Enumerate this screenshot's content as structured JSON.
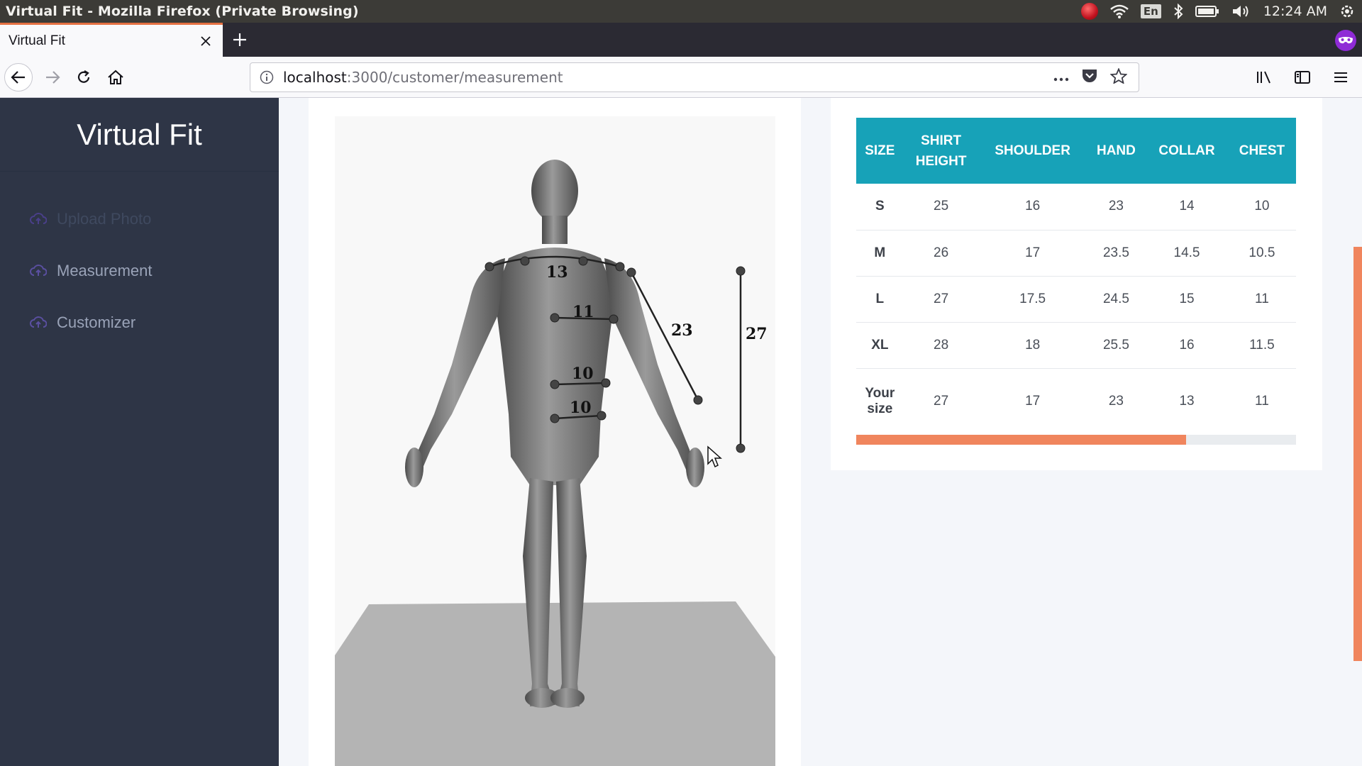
{
  "os": {
    "window_title": "Virtual Fit - Mozilla Firefox (Private Browsing)",
    "lang_indicator": "En",
    "clock": "12:24 AM",
    "tray_icons": [
      "record-icon",
      "wifi-icon",
      "keyboard-lang-icon",
      "bluetooth-icon",
      "battery-icon",
      "volume-icon",
      "power-gear-icon"
    ]
  },
  "browser": {
    "tab_title": "Virtual Fit",
    "url_host": "localhost",
    "url_path": ":3000/customer/measurement",
    "private_color": "#8f2bd6",
    "tab_accent": "#e57042"
  },
  "sidebar": {
    "brand": "Virtual Fit",
    "items": [
      {
        "label": "Upload Photo",
        "icon": "cloud-upload-icon",
        "state": "dim"
      },
      {
        "label": "Measurement",
        "icon": "cloud-upload-icon",
        "state": "normal"
      },
      {
        "label": "Customizer",
        "icon": "cloud-upload-icon",
        "state": "normal"
      }
    ]
  },
  "model": {
    "measurements": {
      "collar": "13",
      "chest": "11",
      "waist": "10",
      "hip": "10",
      "hand": "23",
      "height": "27"
    }
  },
  "size_table": {
    "headers": [
      "SIZE",
      "SHIRT HEIGHT",
      "SHOULDER",
      "HAND",
      "COLLAR",
      "CHEST"
    ],
    "header_lines": [
      [
        "SIZE"
      ],
      [
        "SHIRT",
        "HEIGHT"
      ],
      [
        "SHOULDER"
      ],
      [
        "HAND"
      ],
      [
        "COLLAR"
      ],
      [
        "CHEST"
      ]
    ],
    "rows": [
      [
        "S",
        "25",
        "16",
        "23",
        "14",
        "10"
      ],
      [
        "M",
        "26",
        "17",
        "23.5",
        "14.5",
        "10.5"
      ],
      [
        "L",
        "27",
        "17.5",
        "24.5",
        "15",
        "11"
      ],
      [
        "XL",
        "28",
        "18",
        "25.5",
        "16",
        "11.5"
      ]
    ],
    "your_row": {
      "label_lines": [
        "Your",
        "size"
      ],
      "values": [
        "27",
        "17",
        "23",
        "13",
        "11"
      ]
    },
    "progress": 0.75,
    "header_color": "#17a2b8",
    "progress_color": "#f0855d"
  }
}
